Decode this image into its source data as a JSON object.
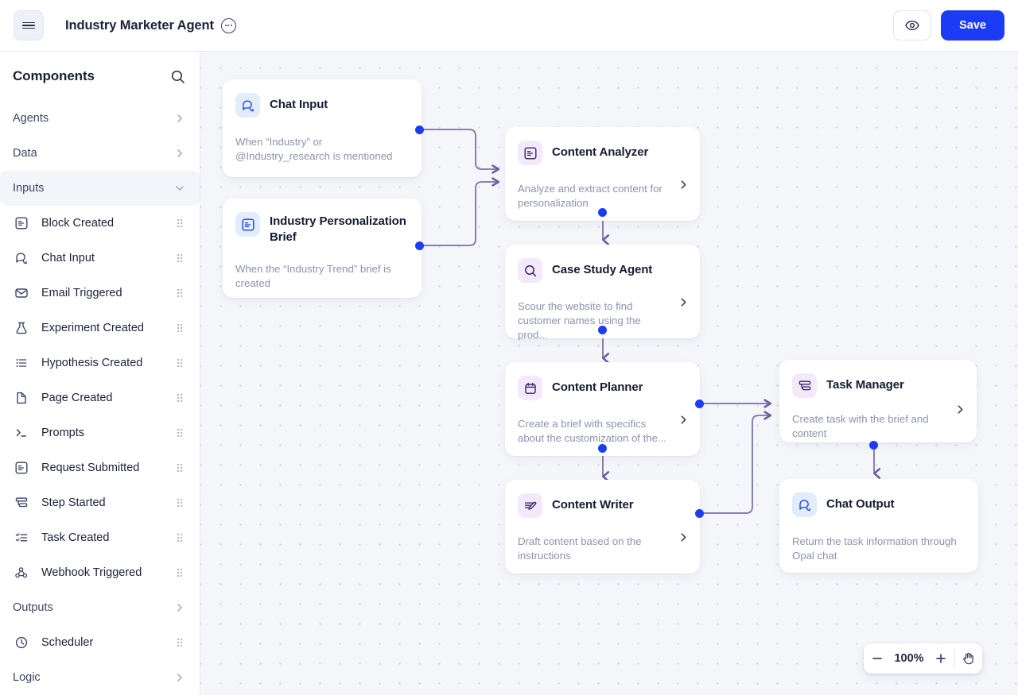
{
  "topbar": {
    "menu_icon": "hamburger-icon",
    "title": "Industry Marketer Agent",
    "more_icon": "ellipsis-circle-icon",
    "preview_icon": "eye-icon",
    "save_label": "Save",
    "accent_color": "#1b3cf4"
  },
  "sidebar": {
    "heading": "Components",
    "search_icon": "search-icon",
    "groups": [
      {
        "label": "Agents",
        "expanded": false,
        "icon": "chevron-right-icon"
      },
      {
        "label": "Data",
        "expanded": false,
        "icon": "chevron-right-icon"
      },
      {
        "label": "Inputs",
        "expanded": true,
        "icon": "chevron-down-icon"
      },
      {
        "label": "Outputs",
        "expanded": false,
        "icon": "chevron-right-icon"
      },
      {
        "label": "Logic",
        "expanded": false,
        "icon": "chevron-right-icon"
      }
    ],
    "input_items": [
      {
        "label": "Block Created",
        "icon": "document-lines-icon",
        "handle": "drag-handle-icon"
      },
      {
        "label": "Chat Input",
        "icon": "chat-bubbles-icon",
        "handle": "drag-handle-icon"
      },
      {
        "label": "Email Triggered",
        "icon": "envelope-icon",
        "handle": "drag-handle-icon"
      },
      {
        "label": "Experiment Created",
        "icon": "flask-icon",
        "handle": "drag-handle-icon"
      },
      {
        "label": "Hypothesis Created",
        "icon": "list-icon",
        "handle": "drag-handle-icon"
      },
      {
        "label": "Page Created",
        "icon": "page-icon",
        "handle": "drag-handle-icon"
      },
      {
        "label": "Prompts",
        "icon": "terminal-icon",
        "handle": "drag-handle-icon"
      },
      {
        "label": "Request Submitted",
        "icon": "document-lines-icon",
        "handle": "drag-handle-icon"
      },
      {
        "label": "Step Started",
        "icon": "step-icon",
        "handle": "drag-handle-icon"
      },
      {
        "label": "Task Created",
        "icon": "checklist-icon",
        "handle": "drag-handle-icon"
      },
      {
        "label": "Webhook Triggered",
        "icon": "webhook-icon",
        "handle": "drag-handle-icon"
      }
    ],
    "output_items": [
      {
        "label": "Scheduler",
        "icon": "clock-icon",
        "handle": "drag-handle-icon"
      }
    ]
  },
  "canvas": {
    "nodes": [
      {
        "id": "chat-input",
        "title": "Chat Input",
        "description": "When “Industry” or @Industry_research is mentioned",
        "icon": "chat-bubbles-icon",
        "icon_style": "blue",
        "has_chevron": false
      },
      {
        "id": "industry-personalization-brief",
        "title": "Industry Personalization Brief",
        "description": "When the “Industry Trend” brief is created",
        "icon": "document-lines-icon",
        "icon_style": "blue",
        "has_chevron": false
      },
      {
        "id": "content-analyzer",
        "title": "Content Analyzer",
        "description": "Analyze and extract content for personalization",
        "icon": "document-lines-icon",
        "icon_style": "purple",
        "has_chevron": true
      },
      {
        "id": "case-study-agent",
        "title": "Case Study Agent",
        "description": "Scour the website to find customer names using the prod...",
        "icon": "search-icon",
        "icon_style": "purple",
        "has_chevron": true
      },
      {
        "id": "content-planner",
        "title": "Content Planner",
        "description": "Create a brief with specifics about the customization of the...",
        "icon": "calendar-icon",
        "icon_style": "purple",
        "has_chevron": true
      },
      {
        "id": "content-writer",
        "title": "Content Writer",
        "description": "Draft content based on the instructions",
        "icon": "pencil-document-icon",
        "icon_style": "purple",
        "has_chevron": true
      },
      {
        "id": "task-manager",
        "title": "Task Manager",
        "description": "Create task with the brief and content",
        "icon": "step-icon",
        "icon_style": "purple",
        "has_chevron": true
      },
      {
        "id": "chat-output",
        "title": "Chat Output",
        "description": "Return the task information through Opal chat",
        "icon": "chat-bubbles-icon",
        "icon_style": "blue",
        "has_chevron": false
      }
    ],
    "edge_color": "#8b7fb0",
    "dot_color": "#1b3cf4"
  },
  "zoom_control": {
    "minus_icon": "minus-icon",
    "level": "100%",
    "plus_icon": "plus-icon",
    "pan_icon": "hand-icon"
  }
}
